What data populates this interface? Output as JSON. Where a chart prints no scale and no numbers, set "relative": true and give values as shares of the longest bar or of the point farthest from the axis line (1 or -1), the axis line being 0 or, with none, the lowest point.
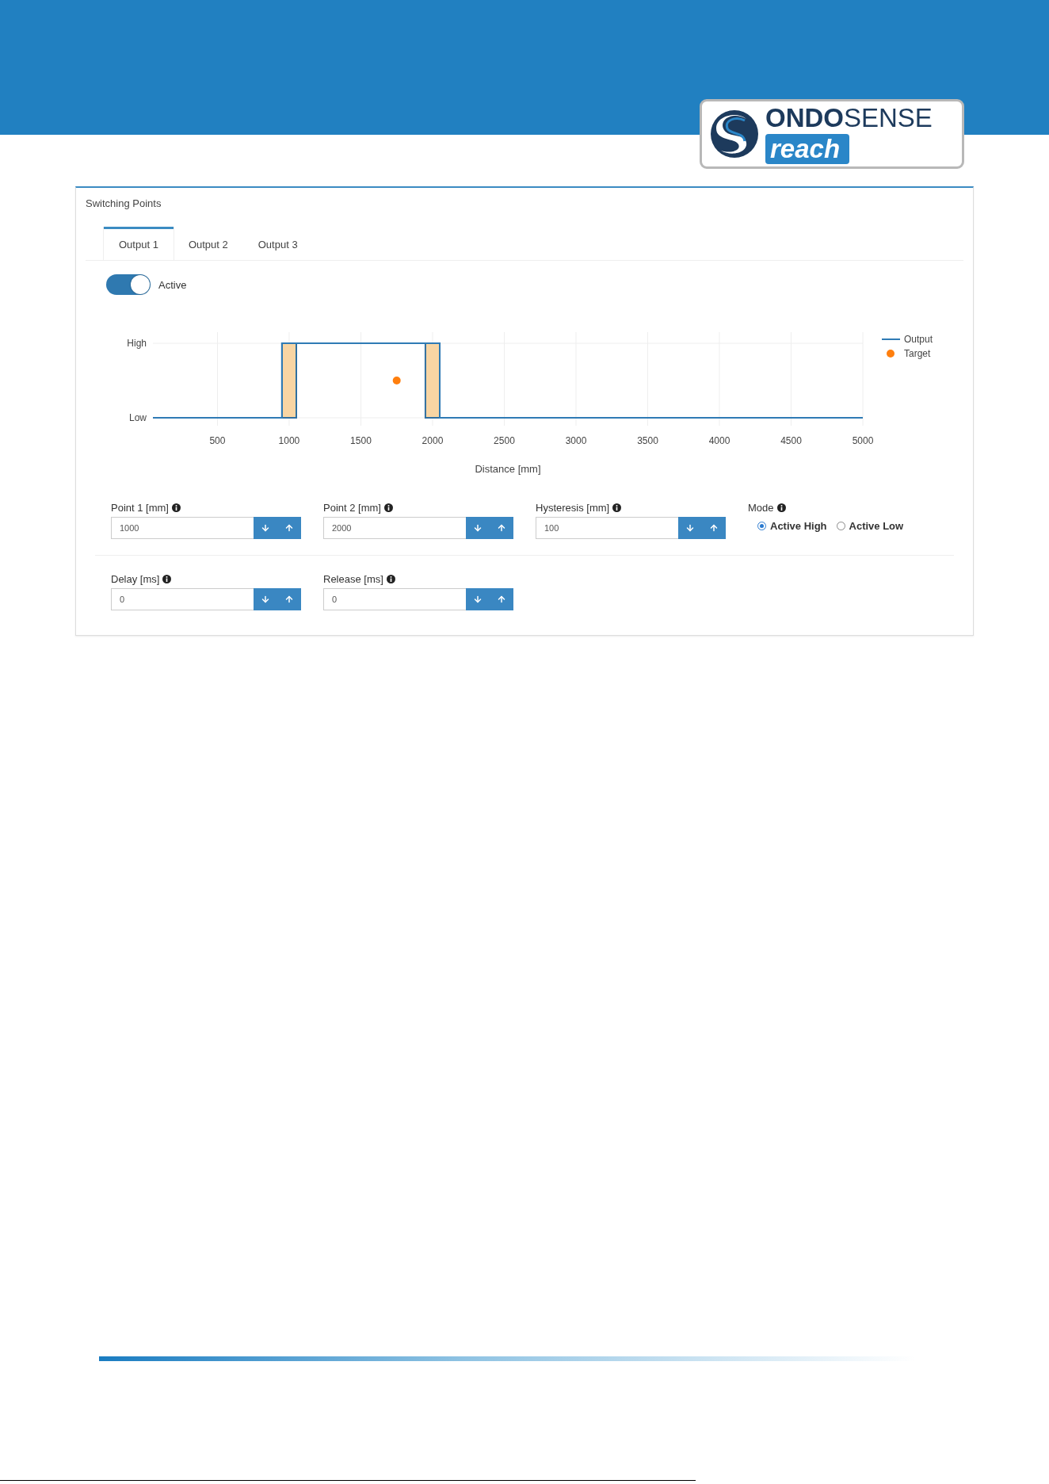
{
  "header": {
    "logo": {
      "brand": "**ONDO**SENSE",
      "product": "reach"
    }
  },
  "panel": {
    "title": "Switching Points",
    "tabs": [
      {
        "label": "Output 1",
        "selected": true
      },
      {
        "label": "Output 2",
        "selected": false
      },
      {
        "label": "Output 3",
        "selected": false
      }
    ],
    "toggle": {
      "label": "Active",
      "on": true
    },
    "chart": {
      "y_labels": [
        "High",
        "Low"
      ],
      "chart_data": {
        "type": "line",
        "xlabel": "Distance [mm]",
        "x": [
          50,
          950,
          950,
          1750,
          2050,
          2050,
          5000
        ],
        "series": [
          {
            "name": "Output",
            "color": "#2f7bb5",
            "values": [
              0,
              0,
              1,
              1,
              1,
              0,
              0
            ]
          },
          {
            "name": "Target",
            "color": "#ff7f0e",
            "marker": "circle",
            "values": [
              null,
              null,
              null,
              0.5,
              null,
              null,
              null
            ]
          }
        ],
        "xlim": [
          50,
          5000
        ],
        "ylim": [
          0,
          1
        ],
        "xticks": [
          500,
          1000,
          1500,
          2000,
          2500,
          3000,
          3500,
          4000,
          4500,
          5000
        ],
        "relative": true,
        "grid": true,
        "legend": true,
        "bands": [
          {
            "axis": "x",
            "from": 950,
            "to": 1050
          },
          {
            "axis": "x",
            "from": 1950,
            "to": 2050
          }
        ]
      }
    },
    "fields": [
      {
        "label": "Point 1 [mm]",
        "value": "1000"
      },
      {
        "label": "Point 2 [mm]",
        "value": "2000"
      },
      {
        "label": "Hysteresis [mm]",
        "value": "100"
      }
    ],
    "mode": {
      "label": "Mode",
      "options": [
        {
          "label": "Active High",
          "selected": true
        },
        {
          "label": "Active Low",
          "selected": false
        }
      ]
    },
    "timing_fields": [
      {
        "label": "Delay [ms]",
        "value": "0"
      },
      {
        "label": "Release [ms]",
        "value": "0"
      }
    ]
  }
}
